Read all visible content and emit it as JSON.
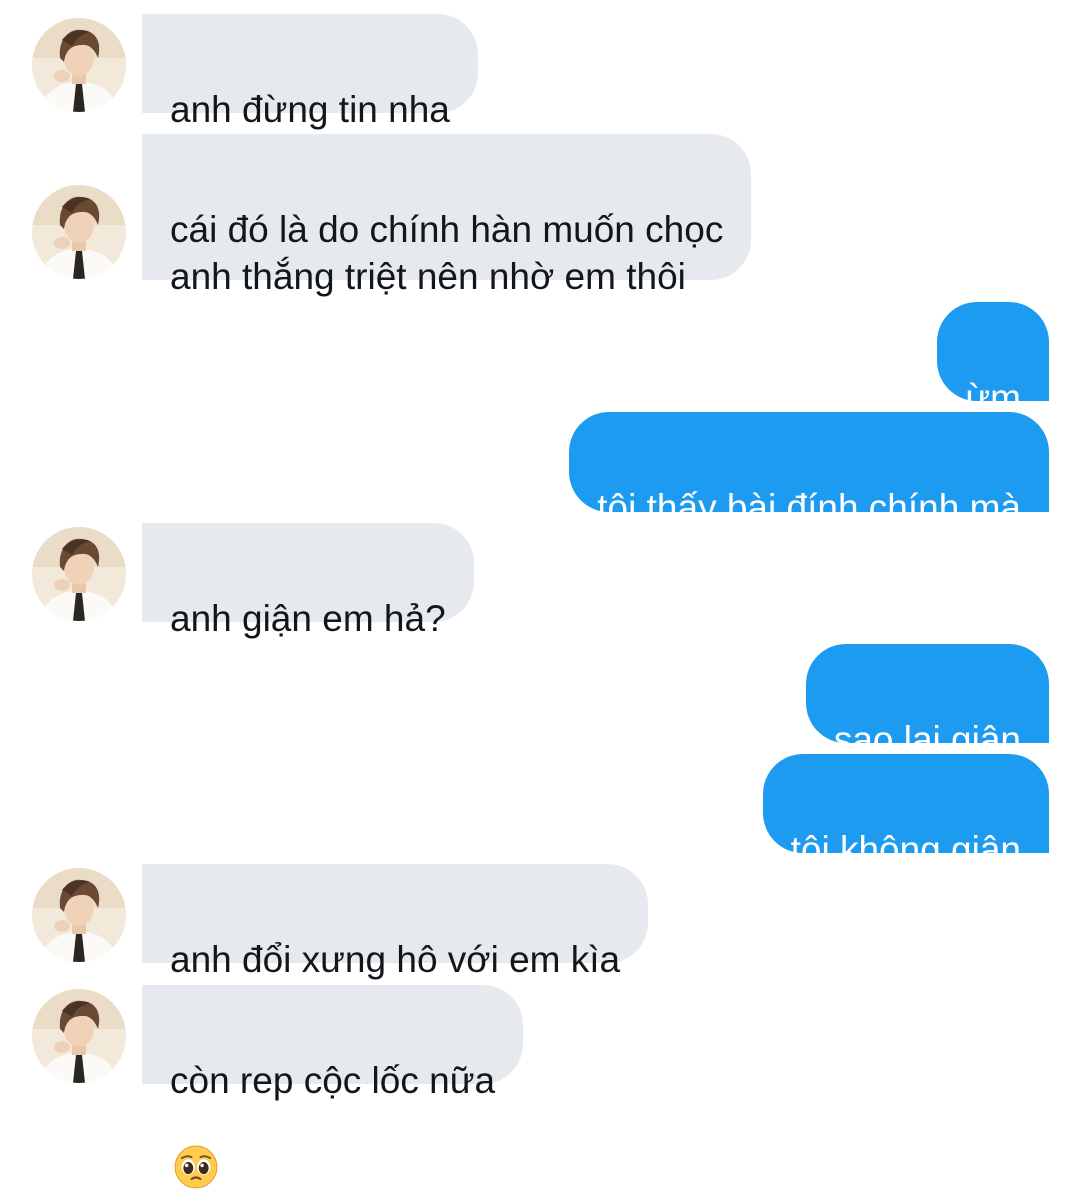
{
  "conversation": {
    "messages": [
      {
        "sender": "them",
        "text": "anh đừng tin nha"
      },
      {
        "sender": "them",
        "text": "cái đó là do chính hàn muốn chọc\nanh thắng triệt nên nhờ em thôi"
      },
      {
        "sender": "me",
        "text": "ừm"
      },
      {
        "sender": "me",
        "text": "tôi thấy bài đính chính mà"
      },
      {
        "sender": "them",
        "text": "anh giận em hả?"
      },
      {
        "sender": "me",
        "text": "sao lại giận"
      },
      {
        "sender": "me",
        "text": "tôi không giận"
      },
      {
        "sender": "them",
        "text": "anh đổi xưng hô với em kìa"
      },
      {
        "sender": "them",
        "text": "còn rep cộc lốc nữa",
        "emoji": "pleading-face-emoji"
      }
    ]
  },
  "colors": {
    "incoming_bubble": "#e6eaee",
    "incoming_text": "#14171a",
    "outgoing_bubble": "#1d9bf0",
    "outgoing_text": "#ffffff"
  }
}
